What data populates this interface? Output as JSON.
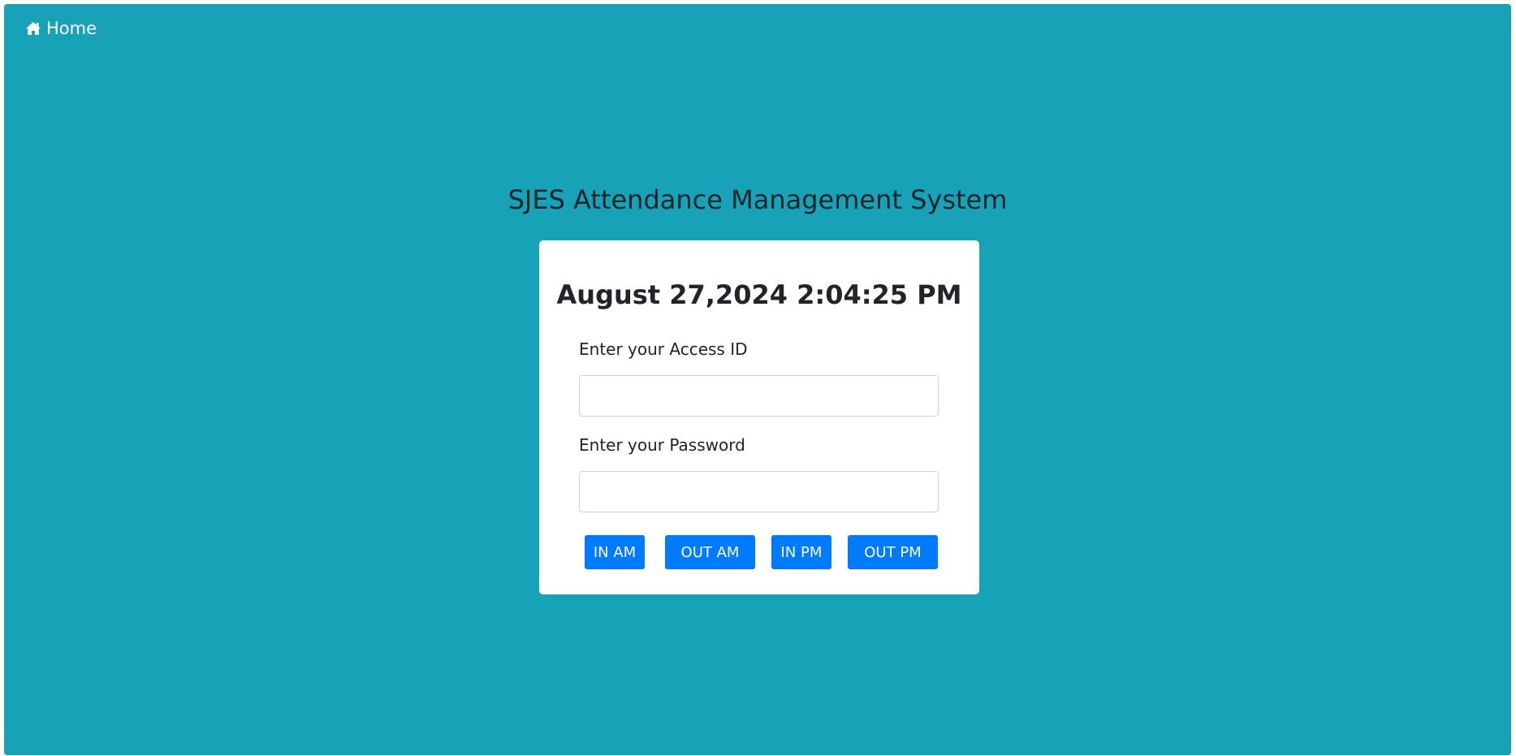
{
  "nav": {
    "home_label": "Home",
    "home_icon": "home-icon"
  },
  "header": {
    "title": "SJES Attendance Management System"
  },
  "card": {
    "clock": "August 27,2024 2:04:25 PM",
    "access_id_label": "Enter your Access ID",
    "access_id_value": "",
    "password_label": "Enter your Password",
    "password_value": "",
    "buttons": {
      "in_am": "IN AM",
      "out_am": "OUT AM",
      "in_pm": "IN PM",
      "out_pm": "OUT PM"
    }
  },
  "colors": {
    "background": "#17a2b8",
    "card": "#ffffff",
    "button": "#007bff",
    "text": "#212529"
  }
}
